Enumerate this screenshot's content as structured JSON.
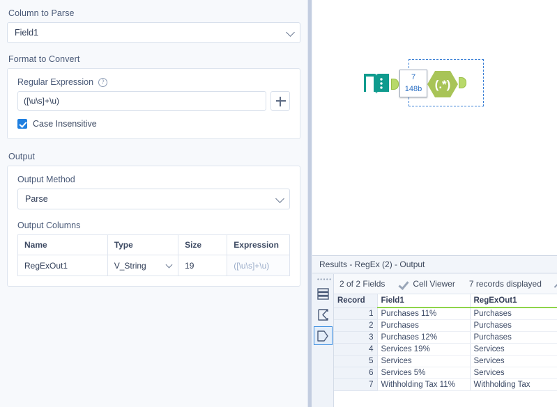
{
  "config": {
    "column_to_parse": {
      "label": "Column to Parse",
      "value": "Field1",
      "chevron_icon": "chevron-down-icon"
    },
    "format_to_convert": {
      "label": "Format to Convert",
      "regex_label": "Regular Expression",
      "help_icon": "help-circle-icon",
      "regex_value": "([\\u\\s]+\\u)",
      "add_button_icon": "plus-icon",
      "case_insensitive_label": "Case Insensitive",
      "case_insensitive_checked": "true"
    },
    "output": {
      "label": "Output",
      "method_label": "Output Method",
      "method_value": "Parse",
      "columns_label": "Output Columns",
      "columns_headers": [
        "Name",
        "Type",
        "Size",
        "Expression"
      ],
      "columns_rows": [
        {
          "name": "RegExOut1",
          "type": "V_String",
          "size": "19",
          "expression": "([\\u\\s]+\\u)"
        }
      ]
    }
  },
  "canvas": {
    "input_tool_icon": "input-data-book-icon",
    "regex_tool_icon": "regex-hexagon-icon",
    "regex_tool_glyph": "(.*)",
    "tooltip_records": "7",
    "tooltip_size": "148b"
  },
  "results": {
    "title": "Results - RegEx (2) - Output",
    "rail": [
      {
        "icon": "data-rows-icon",
        "active": "false"
      },
      {
        "icon": "sigma-summary-icon",
        "active": "false"
      },
      {
        "icon": "output-anchor-icon",
        "active": "true"
      }
    ],
    "toolbar": {
      "fields_label": "2 of 2 Fields",
      "fields_caret_icon": "caret-down-icon",
      "checkmark_icon": "checkmark-icon",
      "cell_viewer_label": "Cell Viewer",
      "cell_viewer_caret_icon": "caret-down-icon",
      "records_label": "7 records displayed",
      "expand_icon": "arrow-up-icon"
    },
    "grid": {
      "headers": [
        "Record",
        "Field1",
        "RegExOut1"
      ],
      "rows": [
        {
          "record": "1",
          "field1": "Purchases 11%",
          "regexout1": "Purchases"
        },
        {
          "record": "2",
          "field1": "Purchases",
          "regexout1": "Purchases"
        },
        {
          "record": "3",
          "field1": "Purchases 12%",
          "regexout1": "Purchases"
        },
        {
          "record": "4",
          "field1": "Services 19%",
          "regexout1": "Services"
        },
        {
          "record": "5",
          "field1": "Services",
          "regexout1": "Services"
        },
        {
          "record": "6",
          "field1": "Services 5%",
          "regexout1": "Services"
        },
        {
          "record": "7",
          "field1": "Withholding Tax 11%",
          "regexout1": "Withholding Tax"
        }
      ]
    }
  },
  "colors": {
    "panel_bg": "#f7f9fc",
    "label_text": "#4a5a78",
    "accent_blue": "#1f7fe0",
    "node_green": "#a8c457",
    "input_teal": "#0f9b8e",
    "header_underline_green": "#8ed44a"
  }
}
